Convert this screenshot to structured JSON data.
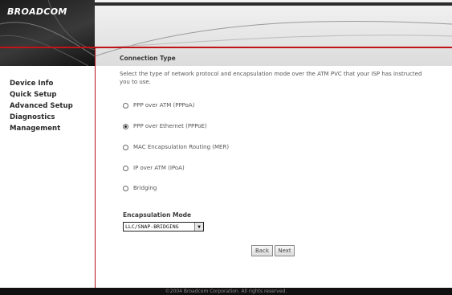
{
  "brand": {
    "logo_text": "BROADCOM"
  },
  "sidebar": {
    "items": [
      {
        "label": "Device Info"
      },
      {
        "label": "Quick Setup"
      },
      {
        "label": "Advanced Setup"
      },
      {
        "label": "Diagnostics"
      },
      {
        "label": "Management"
      }
    ]
  },
  "main": {
    "title": "Connection Type",
    "description": "Select the type of network protocol and encapsulation mode over the ATM PVC that your ISP has instructed you to use.",
    "options": [
      {
        "label": "PPP over ATM (PPPoA)",
        "checked": false
      },
      {
        "label": "PPP over Ethernet (PPPoE)",
        "checked": true
      },
      {
        "label": "MAC Encapsulation Routing (MER)",
        "checked": false
      },
      {
        "label": "IP over ATM (IPoA)",
        "checked": false
      },
      {
        "label": "Bridging",
        "checked": false
      }
    ],
    "encapsulation": {
      "label": "Encapsulation Mode",
      "selected": "LLC/SNAP-BRIDGING"
    },
    "buttons": {
      "back": "Back",
      "next": "Next"
    }
  },
  "footer": {
    "text": "©2004 Broadcom Corporation. All rights reserved."
  },
  "colors": {
    "accent_red": "#c0131a",
    "sidebar_text": "#2a2a2a",
    "header_dark": "#1b1b1b"
  }
}
